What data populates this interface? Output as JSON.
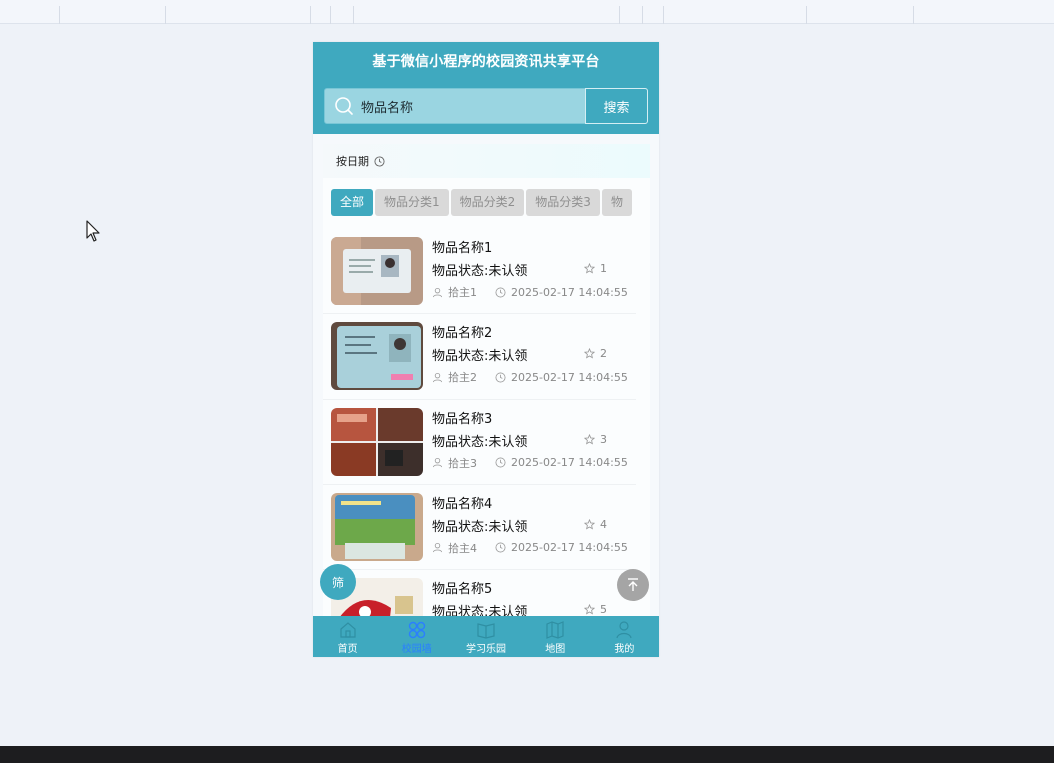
{
  "app": {
    "title": "基于微信小程序的校园资讯共享平台"
  },
  "search": {
    "placeholder": "物品名称",
    "button_label": "搜索"
  },
  "sort": {
    "label": "按日期"
  },
  "categories": [
    {
      "label": "全部",
      "active": true
    },
    {
      "label": "物品分类1",
      "active": false
    },
    {
      "label": "物品分类2",
      "active": false
    },
    {
      "label": "物品分类3",
      "active": false
    },
    {
      "label": "物",
      "active": false
    }
  ],
  "items": [
    {
      "name": "物品名称1",
      "status": "物品状态:未认领",
      "likes": "1",
      "owner": "拾主1",
      "time": "2025-02-17 14:04:55",
      "thumb": "id-card"
    },
    {
      "name": "物品名称2",
      "status": "物品状态:未认领",
      "likes": "2",
      "owner": "拾主2",
      "time": "2025-02-17 14:04:55",
      "thumb": "id-card-blue"
    },
    {
      "name": "物品名称3",
      "status": "物品状态:未认领",
      "likes": "3",
      "owner": "拾主3",
      "time": "2025-02-17 14:04:55",
      "thumb": "wallet-collage"
    },
    {
      "name": "物品名称4",
      "status": "物品状态:未认领",
      "likes": "4",
      "owner": "拾主4",
      "time": "2025-02-17 14:04:55",
      "thumb": "campus-card"
    },
    {
      "name": "物品名称5",
      "status": "物品状态:未认领",
      "likes": "5",
      "owner": "",
      "time": "",
      "thumb": "red-object"
    }
  ],
  "fab": {
    "filter_label": "筛"
  },
  "tabbar": [
    {
      "label": "首页",
      "icon": "home-icon",
      "active": false
    },
    {
      "label": "校园墙",
      "icon": "grid-icon",
      "active": true
    },
    {
      "label": "学习乐园",
      "icon": "book-icon",
      "active": false
    },
    {
      "label": "地图",
      "icon": "map-icon",
      "active": false
    },
    {
      "label": "我的",
      "icon": "user-icon",
      "active": false
    }
  ],
  "colors": {
    "primary": "#3fa9bf",
    "active_tab": "#2b7fff",
    "background": "#eef2f8"
  }
}
